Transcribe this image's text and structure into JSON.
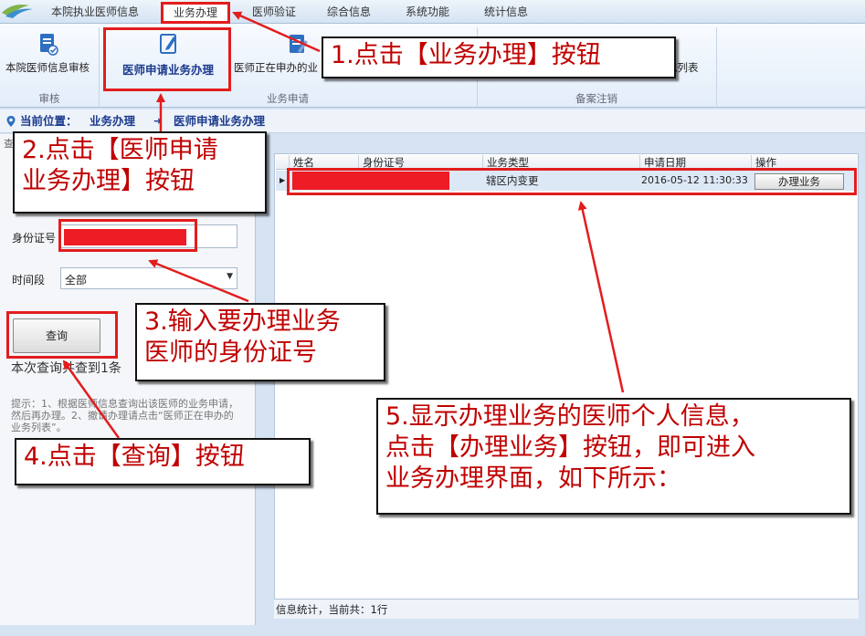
{
  "menu": {
    "items": [
      {
        "label": "本院执业医师信息"
      },
      {
        "label": "业务办理"
      },
      {
        "label": "医师验证"
      },
      {
        "label": "综合信息"
      },
      {
        "label": "系统功能"
      },
      {
        "label": "统计信息"
      }
    ]
  },
  "ribbon": {
    "buttons": [
      {
        "label": "本院医师信息审核"
      },
      {
        "label": "医师申请业务办理"
      },
      {
        "label": "医师正在申办的业"
      },
      {
        "label": "记列表"
      }
    ],
    "groups": [
      {
        "label": "审核"
      },
      {
        "label": "业务申请"
      },
      {
        "label": "备案注销"
      }
    ]
  },
  "location": {
    "prefix": "当前位置：",
    "crumb1": "业务办理",
    "crumb2": "医师申请业务办理"
  },
  "left": {
    "tab_fragment": "查",
    "id_label": "身份证号",
    "time_label": "时间段",
    "time_value": "全部",
    "query_label": "查询",
    "result_text": "本次查询共查到1条",
    "tip_text": "提示：1、根据医师信息查询出该医师的业务申请，然后再办理。2、撤请办理请点击“医师正在申办的业务列表”。"
  },
  "grid": {
    "columns": [
      "姓名",
      "身份证号",
      "业务类型",
      "申请日期",
      "操作"
    ],
    "rows": [
      {
        "type": "辖区内变更",
        "date": "2016-05-12 11:30:33",
        "action": "办理业务"
      }
    ],
    "status": "信息统计，当前共：1行"
  },
  "annotations": {
    "step1": "1.点击【业务办理】按钮",
    "step2_line1": "2.点击【医师申请",
    "step2_line2": "业务办理】按钮",
    "step3_line1": "3.输入要办理业务",
    "step3_line2": "医师的身份证号",
    "step4": "4.点击【查询】按钮",
    "step5_line1": "5.显示办理业务的医师个人信息，",
    "step5_line2": "点击【办理业务】按钮，即可进入",
    "step5_line3": "业务办理界面，如下所示："
  },
  "colors": {
    "annotation_red": "#e21d1d",
    "redaction": "#ee1c25",
    "location_text": "#1b3a8c"
  }
}
